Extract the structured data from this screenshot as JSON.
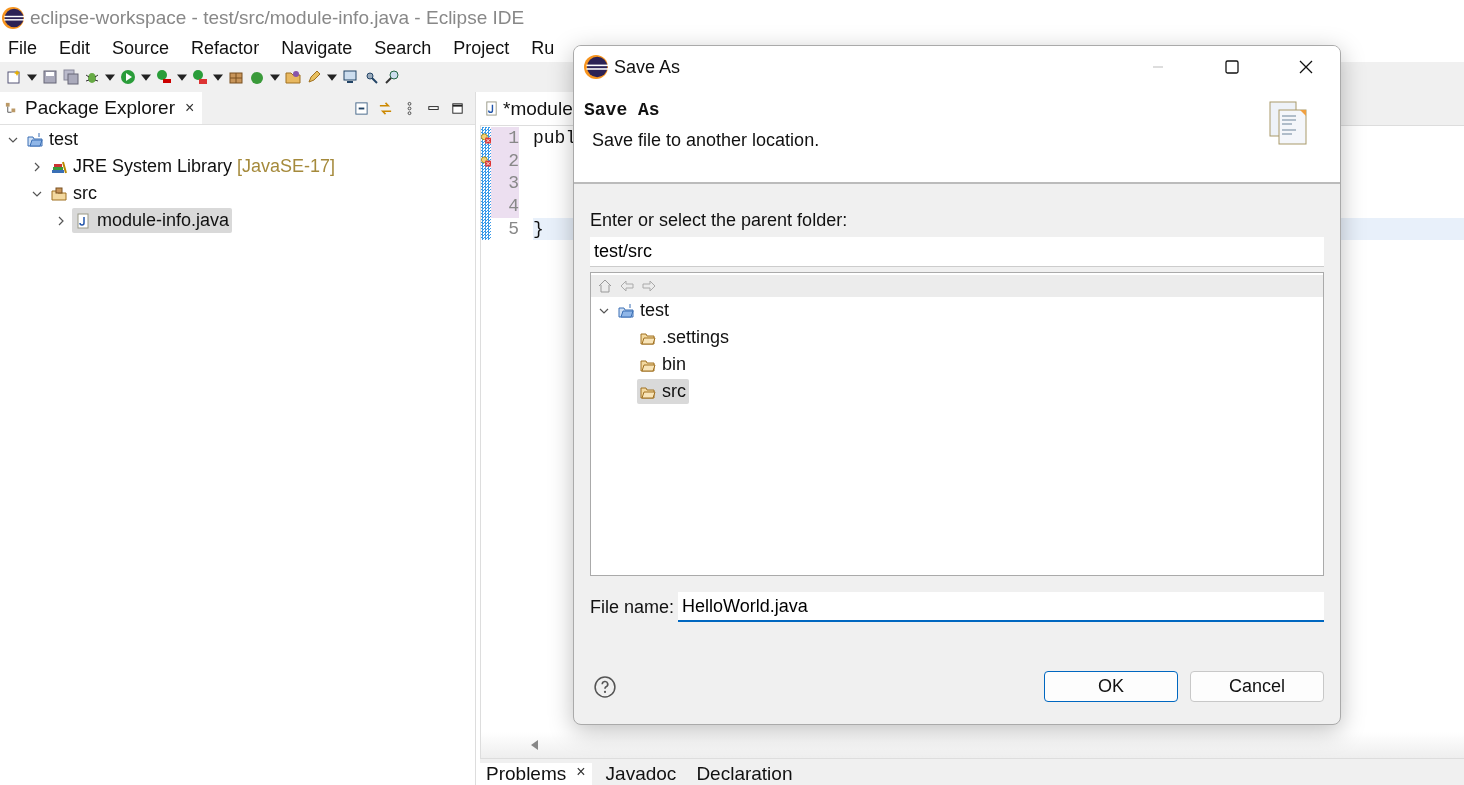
{
  "window": {
    "title": "eclipse-workspace - test/src/module-info.java - Eclipse IDE"
  },
  "menu": [
    "File",
    "Edit",
    "Source",
    "Refactor",
    "Navigate",
    "Search",
    "Project",
    "Ru"
  ],
  "explorer": {
    "tab": {
      "label": "Package Explorer",
      "close": "×"
    },
    "tree": [
      {
        "label": "test",
        "kind": "project",
        "expanded": true,
        "selected": false,
        "children": [
          {
            "label": "JRE System Library",
            "decoration": "[JavaSE-17]",
            "kind": "library",
            "expanded": false,
            "selected": false
          },
          {
            "label": "src",
            "kind": "source-folder",
            "expanded": true,
            "selected": false,
            "children": [
              {
                "label": "module-info.java",
                "kind": "java-file",
                "expanded": false,
                "selected": true
              }
            ]
          }
        ]
      }
    ]
  },
  "editor": {
    "tab": {
      "label": "*module"
    },
    "lines": [
      {
        "number": "1",
        "code": "publ",
        "error": true,
        "changed": true,
        "current": false
      },
      {
        "number": "2",
        "error": true,
        "changed": true,
        "current": false
      },
      {
        "number": "3",
        "error": false,
        "changed": true,
        "current": false
      },
      {
        "number": "4",
        "error": false,
        "changed": true,
        "current": false
      },
      {
        "number": "5",
        "code": "}",
        "error": false,
        "changed": false,
        "current": true
      }
    ]
  },
  "bottom_tabs": [
    {
      "label": "Problems",
      "close": "×",
      "selected": true
    },
    {
      "label": "Javadoc",
      "selected": false
    },
    {
      "label": "Declaration",
      "selected": false
    }
  ],
  "dialog": {
    "title": "Save As",
    "heading": "Save As",
    "message": "Save file to another location.",
    "folder_label": "Enter or select the parent folder:",
    "folder_value": "test/src",
    "tree": [
      {
        "label": "test",
        "kind": "project",
        "expanded": true,
        "selected": false,
        "children": [
          {
            "label": ".settings",
            "kind": "folder",
            "selected": false
          },
          {
            "label": "bin",
            "kind": "folder",
            "selected": false
          },
          {
            "label": "src",
            "kind": "folder",
            "selected": true
          }
        ]
      }
    ],
    "file_name_label": "File name:",
    "file_name_value": "HelloWorld.java",
    "buttons": [
      {
        "label": "OK",
        "default": true
      },
      {
        "label": "Cancel",
        "default": false
      }
    ]
  }
}
